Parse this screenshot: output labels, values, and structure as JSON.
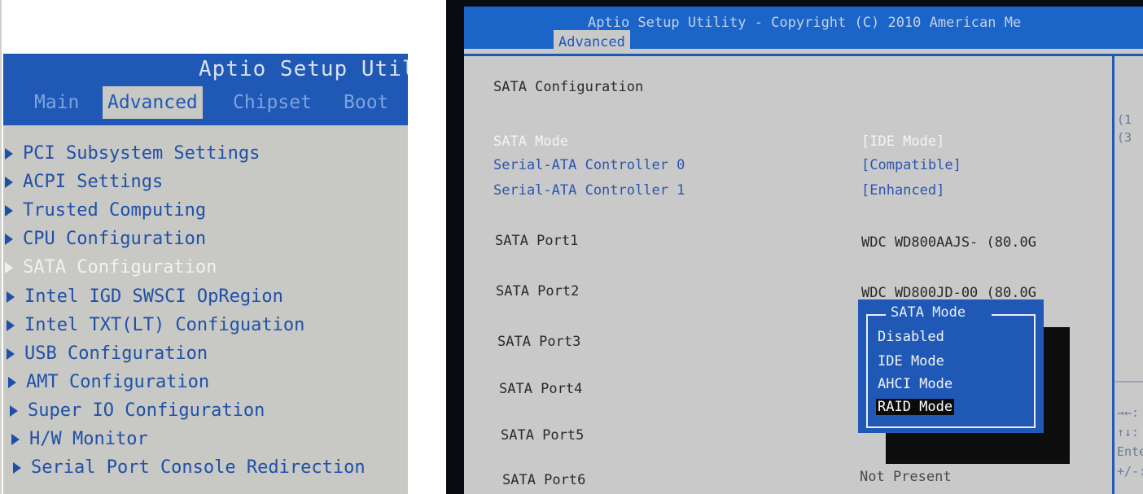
{
  "left_screen": {
    "title": "Aptio Setup Utili",
    "tabs": [
      {
        "label": "Main",
        "active": false
      },
      {
        "label": "Advanced",
        "active": true
      },
      {
        "label": "Chipset",
        "active": false
      },
      {
        "label": "Boot",
        "active": false
      }
    ],
    "menu": [
      {
        "label": "PCI Subsystem Settings",
        "selected": false
      },
      {
        "label": "ACPI Settings",
        "selected": false
      },
      {
        "label": "Trusted Computing",
        "selected": false
      },
      {
        "label": "CPU Configuration",
        "selected": false
      },
      {
        "label": "SATA Configuration",
        "selected": true
      },
      {
        "label": "Intel IGD SWSCI OpRegion",
        "selected": false
      },
      {
        "label": "Intel TXT(LT) Configuation",
        "selected": false
      },
      {
        "label": "USB Configuration",
        "selected": false
      },
      {
        "label": "AMT Configuration",
        "selected": false
      },
      {
        "label": "Super IO Configuration",
        "selected": false
      },
      {
        "label": "H/W Monitor",
        "selected": false
      },
      {
        "label": "Serial Port Console Redirection",
        "selected": false
      }
    ]
  },
  "right_screen": {
    "title": "Aptio Setup Utility - Copyright (C) 2010 American Me",
    "active_tab": "Advanced",
    "section_heading": "SATA Configuration",
    "settings": [
      {
        "label": "SATA Mode",
        "value": "[IDE Mode]"
      },
      {
        "label": "Serial-ATA Controller 0",
        "value": "[Compatible]"
      },
      {
        "label": "Serial-ATA Controller 1",
        "value": "[Enhanced]"
      }
    ],
    "ports": [
      {
        "label": "SATA Port1",
        "value": "WDC WD800AAJS- (80.0G"
      },
      {
        "label": "SATA Port2",
        "value": "WDC WD800JD-00 (80.0G"
      },
      {
        "label": "SATA Port3",
        "value": ""
      },
      {
        "label": "SATA Port4",
        "value": ""
      },
      {
        "label": "SATA Port5",
        "value": ""
      },
      {
        "label": "SATA Port6",
        "value": "Not Present"
      }
    ],
    "help_top": [
      "(1",
      "(3"
    ],
    "help_keys": [
      "→←:",
      "↑↓:",
      "Ente",
      "+/-:"
    ],
    "popup": {
      "title": "SATA Mode",
      "options": [
        "Disabled",
        "IDE Mode",
        "AHCI Mode",
        "RAID Mode"
      ],
      "selected_index": 3
    }
  },
  "colors": {
    "bios_blue": "#1f58b5",
    "bios_grey": "#c9c9c9",
    "highlight_white": "#f4f4f4"
  }
}
